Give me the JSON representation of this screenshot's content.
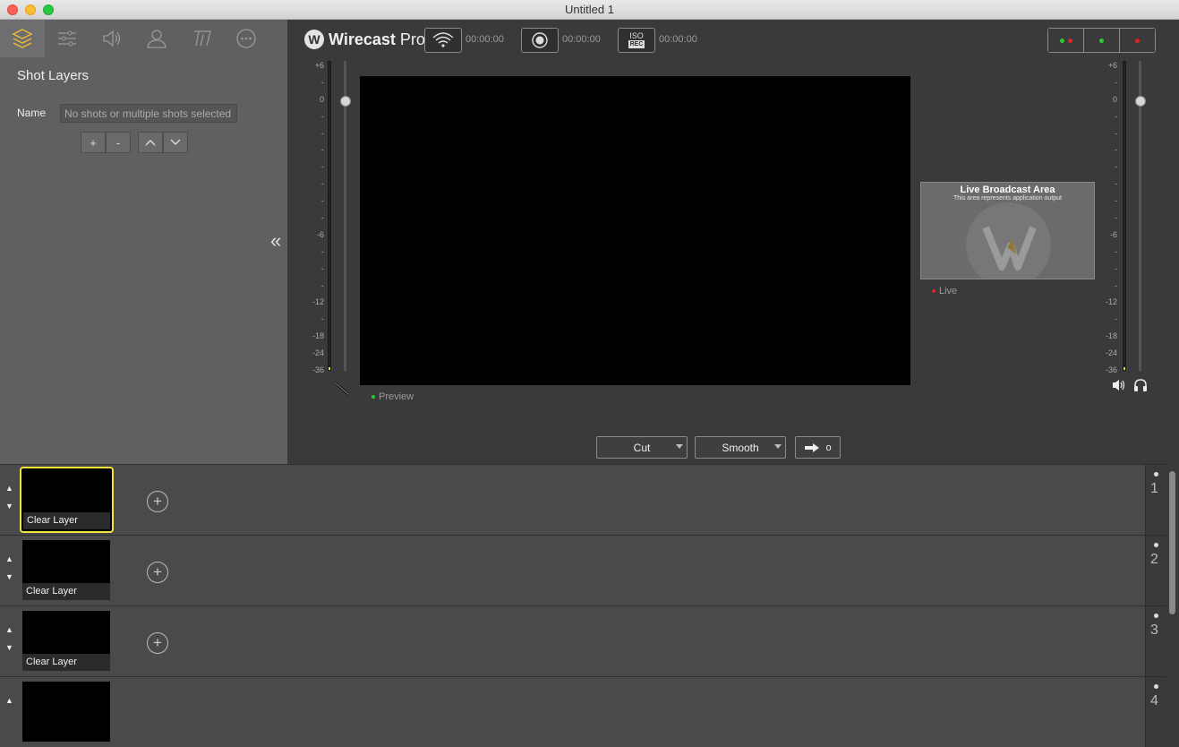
{
  "window": {
    "title": "Untitled 1"
  },
  "left_panel": {
    "tabs": [
      {
        "name": "layers-icon"
      },
      {
        "name": "sliders-icon"
      },
      {
        "name": "speaker-icon"
      },
      {
        "name": "person-icon"
      },
      {
        "name": "text-icon"
      },
      {
        "name": "more-icon"
      }
    ],
    "title": "Shot Layers",
    "name_label": "Name",
    "name_placeholder": "No shots or multiple shots selected",
    "btn_add": "+",
    "btn_remove": "-",
    "collapse": "«"
  },
  "toolbar": {
    "brand": "Wirecast",
    "brand_suffix": " Pro",
    "stream_time": "00:00:00",
    "record_time": "00:00:00",
    "iso_label_top": "ISO",
    "iso_label_bottom": "REC",
    "iso_time": "00:00:00"
  },
  "meter_left": {
    "labels": [
      "+6",
      "-",
      "0",
      "-",
      "-",
      "-",
      "-",
      "-",
      "-",
      "-",
      "-6",
      "-",
      "-",
      "-",
      "-12",
      "-",
      "-18",
      "-24",
      "-36"
    ]
  },
  "meter_right": {
    "labels": [
      "+6",
      "-",
      "0",
      "-",
      "-",
      "-",
      "-",
      "-",
      "-",
      "-",
      "-6",
      "-",
      "-",
      "-",
      "-12",
      "-",
      "-18",
      "-24",
      "-36"
    ]
  },
  "preview": {
    "label": "Preview"
  },
  "live": {
    "title": "Live Broadcast Area",
    "subtitle": "This area represents application output",
    "label": "Live"
  },
  "transition": {
    "cut": "Cut",
    "smooth": "Smooth",
    "go_suffix": "o"
  },
  "layers": [
    {
      "number": "1",
      "shot": "Clear Layer"
    },
    {
      "number": "2",
      "shot": "Clear Layer"
    },
    {
      "number": "3",
      "shot": "Clear Layer"
    },
    {
      "number": "4",
      "shot": ""
    }
  ],
  "colors": {
    "accent": "#e8b93a",
    "selected": "#f1e33b",
    "live": "#e02424",
    "preview": "#2ec92e"
  }
}
